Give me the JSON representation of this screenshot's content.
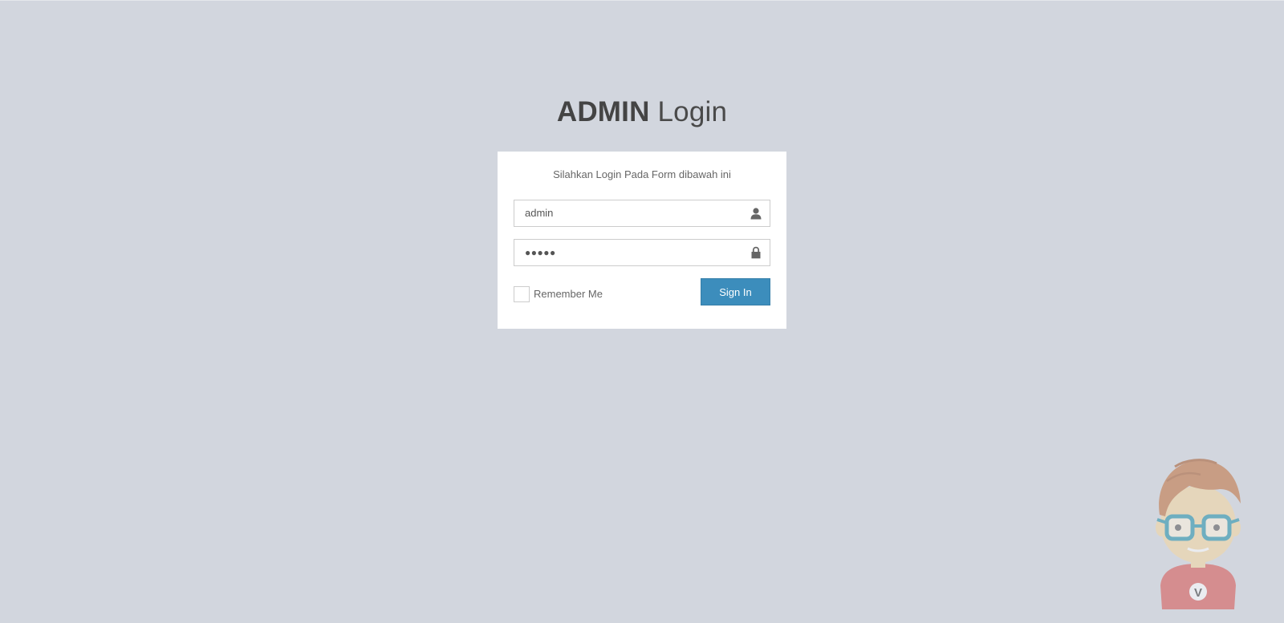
{
  "logo": {
    "bold": "ADMIN",
    "light": "Login"
  },
  "login_box": {
    "message": "Silahkan Login Pada Form dibawah ini",
    "username": {
      "value": "admin",
      "icon": "user-icon"
    },
    "password": {
      "value": "●●●●●",
      "icon": "lock-icon"
    },
    "remember_label": "Remember Me",
    "signin_label": "Sign In"
  },
  "mascot": {
    "badge_letter": "V"
  },
  "colors": {
    "background": "#d2d6de",
    "primary_button": "#3c8dbc",
    "box": "#ffffff"
  }
}
